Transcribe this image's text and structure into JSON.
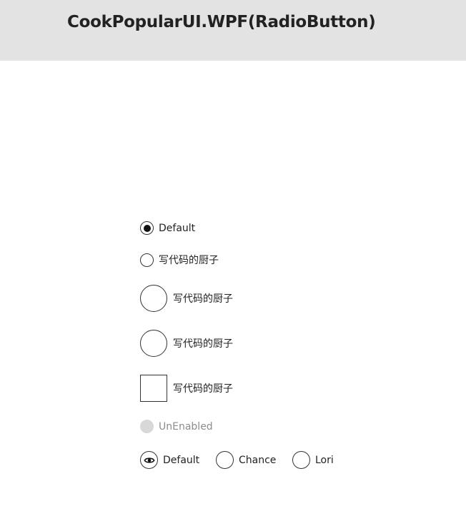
{
  "window": {
    "title": "CookPopularUI.WPF(RadioButton)"
  },
  "radios": {
    "default": {
      "label": "Default",
      "checked": true
    },
    "small": {
      "label": "写代码的厨子",
      "checked": false
    },
    "large_circle_1": {
      "label": "写代码的厨子",
      "checked": false
    },
    "large_circle_2": {
      "label": "写代码的厨子",
      "checked": false
    },
    "square": {
      "label": "写代码的厨子",
      "checked": false
    },
    "disabled": {
      "label": "UnEnabled",
      "enabled": false
    }
  },
  "group": {
    "items": [
      {
        "label": "Default",
        "checked": true,
        "icon": "eye-icon"
      },
      {
        "label": "Chance",
        "checked": false
      },
      {
        "label": "Lori",
        "checked": false
      }
    ]
  },
  "colors": {
    "title_bar": "#e3e3e3",
    "border": "#333333",
    "disabled_fill": "#d8d8d8",
    "disabled_text": "#8c8c8c"
  }
}
